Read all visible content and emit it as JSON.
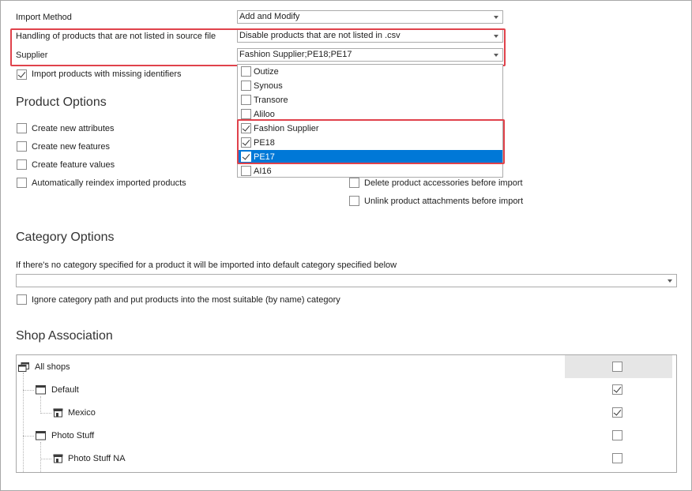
{
  "import_method": {
    "label": "Import Method",
    "value": "Add and Modify"
  },
  "handling": {
    "label": "Handling of products that are not listed in source file",
    "value": "Disable products that are not listed in .csv"
  },
  "supplier": {
    "label": "Supplier",
    "value": "Fashion Supplier;PE18;PE17"
  },
  "import_missing_identifiers": {
    "label": "Import products with missing identifiers",
    "checked": true
  },
  "supplier_dropdown": {
    "items": [
      {
        "label": "Outize",
        "checked": false,
        "selected": false
      },
      {
        "label": "Synous",
        "checked": false,
        "selected": false
      },
      {
        "label": "Transore",
        "checked": false,
        "selected": false
      },
      {
        "label": "Aliloo",
        "checked": false,
        "selected": false
      },
      {
        "label": "Fashion Supplier",
        "checked": true,
        "selected": false
      },
      {
        "label": "PE18",
        "checked": true,
        "selected": false
      },
      {
        "label": "PE17",
        "checked": true,
        "selected": true
      },
      {
        "label": "AI16",
        "checked": false,
        "selected": false
      }
    ]
  },
  "product_options": {
    "title": "Product Options",
    "left": [
      {
        "label": "Create new attributes",
        "checked": false
      },
      {
        "label": "Create new features",
        "checked": false
      },
      {
        "label": "Create feature values",
        "checked": false
      },
      {
        "label": "Automatically reindex imported products",
        "checked": false
      }
    ],
    "right": [
      {
        "label": "Delete product accessories before import",
        "checked": false
      },
      {
        "label": "Unlink product attachments before import",
        "checked": false
      }
    ]
  },
  "category_options": {
    "title": "Category Options",
    "description": "If there's no category specified for a product it will be imported into default category specified below",
    "default_category_value": "",
    "ignore_path": {
      "label": "Ignore category path and put products into the most suitable (by name) category",
      "checked": false
    }
  },
  "shop_association": {
    "title": "Shop Association",
    "rows": [
      {
        "label": "All shops",
        "checked": false
      },
      {
        "label": "Default",
        "checked": true
      },
      {
        "label": "Mexico",
        "checked": true
      },
      {
        "label": "Photo Stuff",
        "checked": false
      },
      {
        "label": "Photo Stuff NA",
        "checked": false
      }
    ]
  },
  "colors": {
    "highlight_border": "#e0424b",
    "selection": "#0078d7"
  }
}
